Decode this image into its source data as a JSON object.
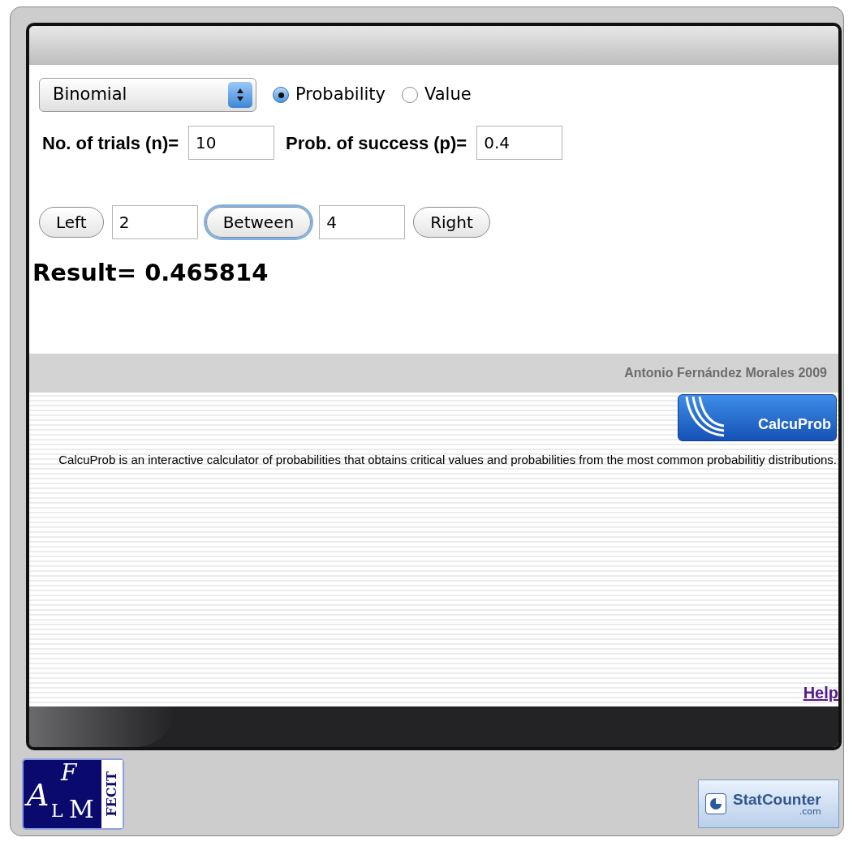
{
  "distribution": {
    "value": "Binomial"
  },
  "mode_options": [
    {
      "label": "Probability",
      "selected": true
    },
    {
      "label": "Value",
      "selected": false
    }
  ],
  "parameters": [
    {
      "label": "No. of trials (n)=",
      "value": "10"
    },
    {
      "label": "Prob. of success (p)=",
      "value": "0.4"
    }
  ],
  "bounds": {
    "buttons": [
      {
        "label": "Left",
        "focused": false
      },
      {
        "label": "Between",
        "focused": true
      },
      {
        "label": "Right",
        "focused": false
      }
    ],
    "lower_value": "2",
    "upper_value": "4"
  },
  "result": {
    "label": "Result=",
    "value": "0.465814"
  },
  "credit": "Antonio Fernández Morales 2009",
  "calcuprob_logo": {
    "text": "CalcuProb"
  },
  "description": "CalcuProb is an interactive calculator of probabilities that obtains critical values and probabilities from the most common probabilitiy distributions.",
  "help_link": "Help",
  "afm_logo": {
    "letters": [
      "F",
      "A",
      "L",
      "M"
    ],
    "side_text": "FECIT"
  },
  "statcounter_badge": {
    "text": "StatCounter",
    "subtext": ".com"
  }
}
